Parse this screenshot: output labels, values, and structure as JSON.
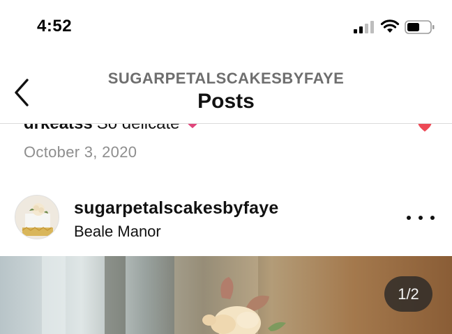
{
  "status_bar": {
    "time": "4:52"
  },
  "header": {
    "account_name": "SUGARPETALSCAKESBYFAYE",
    "title": "Posts"
  },
  "comment": {
    "username": "drkeatss",
    "text": "So delicate"
  },
  "post_date": "October 3, 2020",
  "post": {
    "username": "sugarpetalscakesbyfaye",
    "location": "Beale Manor",
    "image_counter": "1/2"
  },
  "icons": {
    "back": "chevron-left-icon",
    "more": "more-horizontal-icon",
    "signal": "cellular-signal-icon",
    "wifi": "wifi-icon",
    "battery": "battery-icon",
    "heart": "heart-icon"
  },
  "colors": {
    "like_heart": "#ed4956",
    "emoji_heart": "#e0457b",
    "secondary_text": "#8e8e8e"
  }
}
